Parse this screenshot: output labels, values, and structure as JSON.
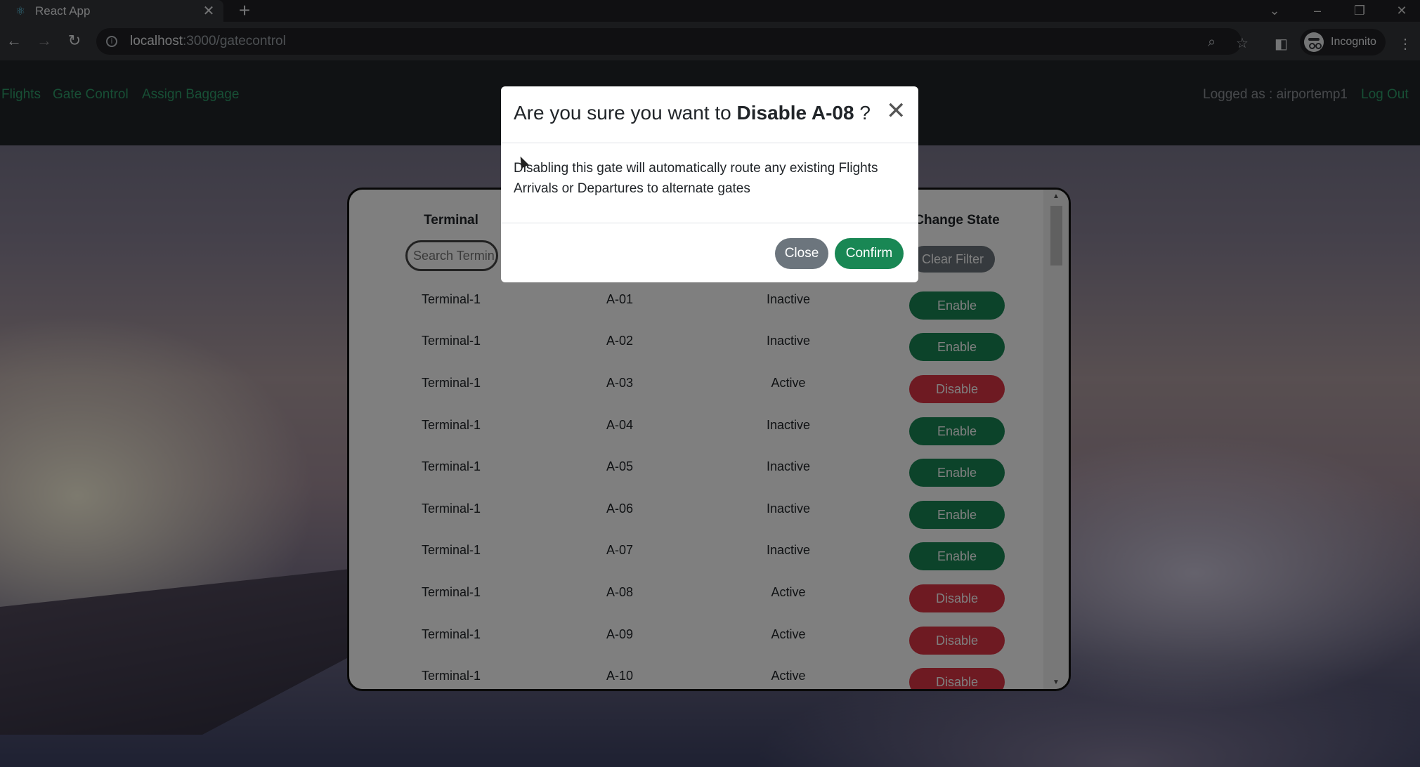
{
  "browser": {
    "tab_title": "React App",
    "url_host": "localhost",
    "url_path": ":3000/gatecontrol",
    "profile_label": "Incognito"
  },
  "nav": {
    "links": [
      "Flights",
      "Gate Control",
      "Assign Baggage"
    ],
    "logged_as": "Logged as : airportemp1",
    "logout": "Log Out"
  },
  "table": {
    "headers": [
      "Terminal",
      "",
      "",
      "Change State"
    ],
    "search_placeholder": "Search Terminal",
    "clear_filter_label": "Clear Filter",
    "rows": [
      {
        "terminal": "Terminal-1",
        "gate": "A-01",
        "status": "Inactive",
        "action": "Enable"
      },
      {
        "terminal": "Terminal-1",
        "gate": "A-02",
        "status": "Inactive",
        "action": "Enable"
      },
      {
        "terminal": "Terminal-1",
        "gate": "A-03",
        "status": "Active",
        "action": "Disable"
      },
      {
        "terminal": "Terminal-1",
        "gate": "A-04",
        "status": "Inactive",
        "action": "Enable"
      },
      {
        "terminal": "Terminal-1",
        "gate": "A-05",
        "status": "Inactive",
        "action": "Enable"
      },
      {
        "terminal": "Terminal-1",
        "gate": "A-06",
        "status": "Inactive",
        "action": "Enable"
      },
      {
        "terminal": "Terminal-1",
        "gate": "A-07",
        "status": "Inactive",
        "action": "Enable"
      },
      {
        "terminal": "Terminal-1",
        "gate": "A-08",
        "status": "Active",
        "action": "Disable"
      },
      {
        "terminal": "Terminal-1",
        "gate": "A-09",
        "status": "Active",
        "action": "Disable"
      },
      {
        "terminal": "Terminal-1",
        "gate": "A-10",
        "status": "Active",
        "action": "Disable"
      }
    ]
  },
  "modal": {
    "title_prefix": "Are you sure you want to ",
    "title_action": "Disable A-08",
    "title_suffix": " ?",
    "body": "Disabling this gate will automatically route any existing Flights Arrivals or Departures to alternate gates",
    "close_label": "Close",
    "confirm_label": "Confirm"
  },
  "colors": {
    "enable": "#198754",
    "disable": "#dc3545",
    "secondary": "#6c757d"
  }
}
